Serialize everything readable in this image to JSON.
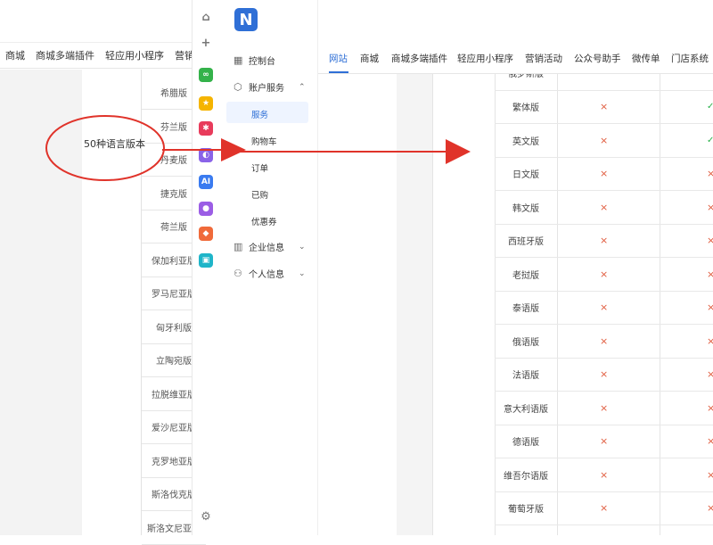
{
  "background_page": {
    "nav_items": [
      "商城",
      "商城多端插件",
      "轻应用小程序",
      "营销"
    ],
    "language_rows": [
      "希腊版",
      "芬兰版",
      "丹麦版",
      "捷克版",
      "荷兰版",
      "保加利亚版",
      "罗马尼亚版",
      "匈牙利版",
      "立陶宛版",
      "拉脱维亚版",
      "爱沙尼亚版",
      "克罗地亚版",
      "斯洛伐克版",
      "斯洛文尼亚版"
    ],
    "annotation_label": "50种语言版本"
  },
  "logo": {
    "letter": "N"
  },
  "sidebar": {
    "items": [
      {
        "icon": "grid-icon",
        "glyph": "▦",
        "label": "控制台"
      },
      {
        "icon": "cube-icon",
        "glyph": "⬡",
        "label": "账户服务",
        "chevron": "⌃"
      }
    ],
    "sub_items": [
      "服务",
      "购物车",
      "订单",
      "已购",
      "优惠券"
    ],
    "items_bottom": [
      {
        "icon": "building-icon",
        "glyph": "▥",
        "label": "企业信息",
        "chevron": "⌄"
      },
      {
        "icon": "person-icon",
        "glyph": "⚇",
        "label": "个人信息",
        "chevron": "⌄"
      }
    ]
  },
  "top_nav": {
    "tabs": [
      "网站",
      "商城",
      "商城多端插件",
      "轻应用小程序",
      "营销活动",
      "公众号助手",
      "微传单",
      "门店系统"
    ],
    "active_tab": "网站"
  },
  "table": {
    "partial_top_row": "俄罗斯版",
    "rows": [
      {
        "name": "繁体版",
        "col1": "×",
        "col2": "✓"
      },
      {
        "name": "英文版",
        "col1": "×",
        "col2": "✓"
      },
      {
        "name": "日文版",
        "col1": "×",
        "col2": "×"
      },
      {
        "name": "韩文版",
        "col1": "×",
        "col2": "×"
      },
      {
        "name": "西班牙版",
        "col1": "×",
        "col2": "×"
      },
      {
        "name": "老挝版",
        "col1": "×",
        "col2": "×"
      },
      {
        "name": "泰语版",
        "col1": "×",
        "col2": "×"
      },
      {
        "name": "俄语版",
        "col1": "×",
        "col2": "×"
      },
      {
        "name": "法语版",
        "col1": "×",
        "col2": "×"
      },
      {
        "name": "意大利语版",
        "col1": "×",
        "col2": "×"
      },
      {
        "name": "德语版",
        "col1": "×",
        "col2": "×"
      },
      {
        "name": "维吾尔语版",
        "col1": "×",
        "col2": "×"
      },
      {
        "name": "葡萄牙版",
        "col1": "×",
        "col2": "×"
      }
    ]
  },
  "rail_icons": [
    {
      "name": "home-icon",
      "glyph": "⌂",
      "color": "#ffffff"
    },
    {
      "name": "plus-icon",
      "glyph": "+",
      "color": "#ffffff"
    },
    {
      "name": "link-app-icon",
      "glyph": "∞",
      "color": "#34b24a"
    },
    {
      "name": "star-app-icon",
      "glyph": "★",
      "color": "#f5b400"
    },
    {
      "name": "network-app-icon",
      "glyph": "✱",
      "color": "#e83b5b"
    },
    {
      "name": "circle-app-icon",
      "glyph": "◐",
      "color": "#8a63e8"
    },
    {
      "name": "ai-app-icon",
      "glyph": "AI",
      "color": "#3a7bf0"
    },
    {
      "name": "chat-app-icon",
      "glyph": "●",
      "color": "#9b5de5"
    },
    {
      "name": "gamepad-app-icon",
      "glyph": "◆",
      "color": "#f06a3a"
    },
    {
      "name": "tool-app-icon",
      "glyph": "▣",
      "color": "#1fb5c9"
    },
    {
      "name": "settings-icon",
      "glyph": "⚙",
      "color": "#ffffff"
    }
  ],
  "colors": {
    "accent": "#2f6fd6",
    "annotation": "#e0332a",
    "cross": "#e05a3c",
    "check": "#2bb24c"
  }
}
